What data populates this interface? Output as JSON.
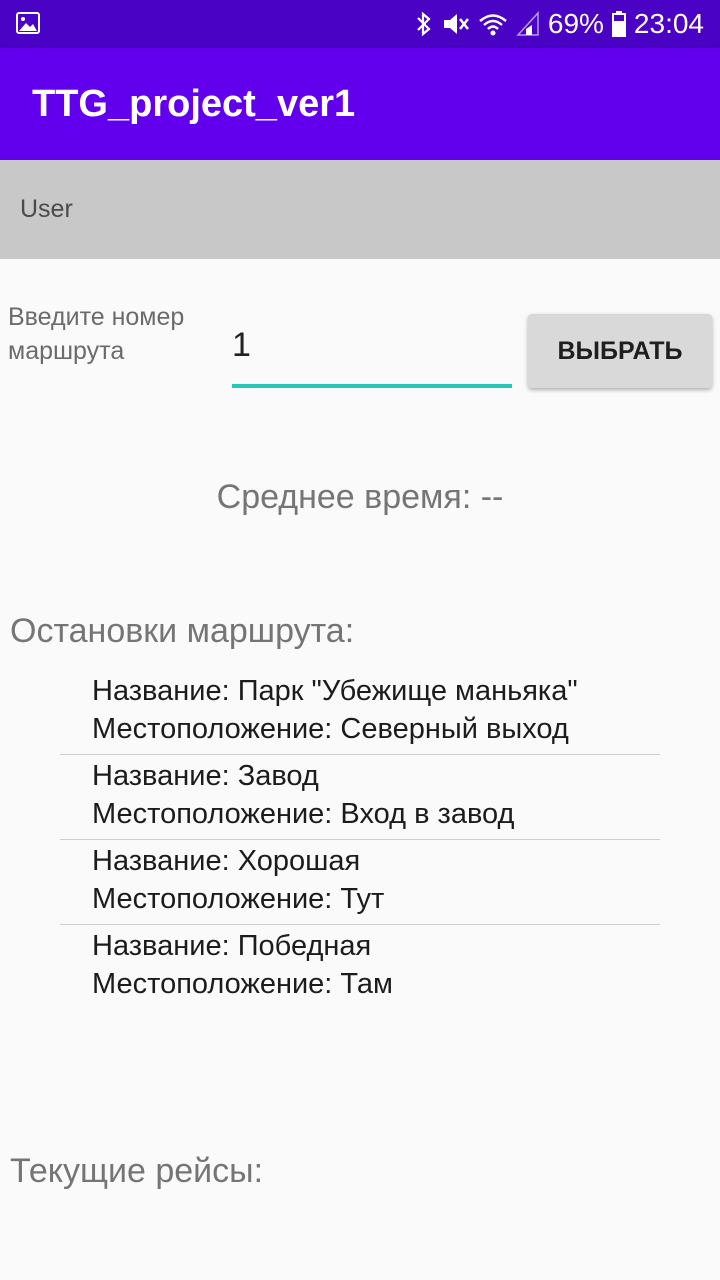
{
  "status_bar": {
    "battery": "69%",
    "time": "23:04"
  },
  "app_bar": {
    "title": "TTG_project_ver1"
  },
  "user_strip": {
    "label": "User"
  },
  "route_form": {
    "prompt": "Введите номер маршрута",
    "value": "1",
    "button_label": "ВЫБРАТЬ"
  },
  "average_time": "Среднее время: --",
  "stops": {
    "heading": "Остановки маршрута:",
    "items": [
      {
        "name": "Название: Парк \"Убежище маньяка\"",
        "location": "Местоположение: Северный выход"
      },
      {
        "name": "Название: Завод",
        "location": "Местоположение: Вход в завод"
      },
      {
        "name": "Название: Хорошая",
        "location": "Местоположение: Тут"
      },
      {
        "name": "Название: Победная",
        "location": "Местоположение: Там"
      }
    ]
  },
  "trips": {
    "heading": "Текущие рейсы:"
  },
  "colors": {
    "status_bar": "#4a02c4",
    "app_bar": "#6200ee",
    "input_underline": "#26c6b8"
  }
}
